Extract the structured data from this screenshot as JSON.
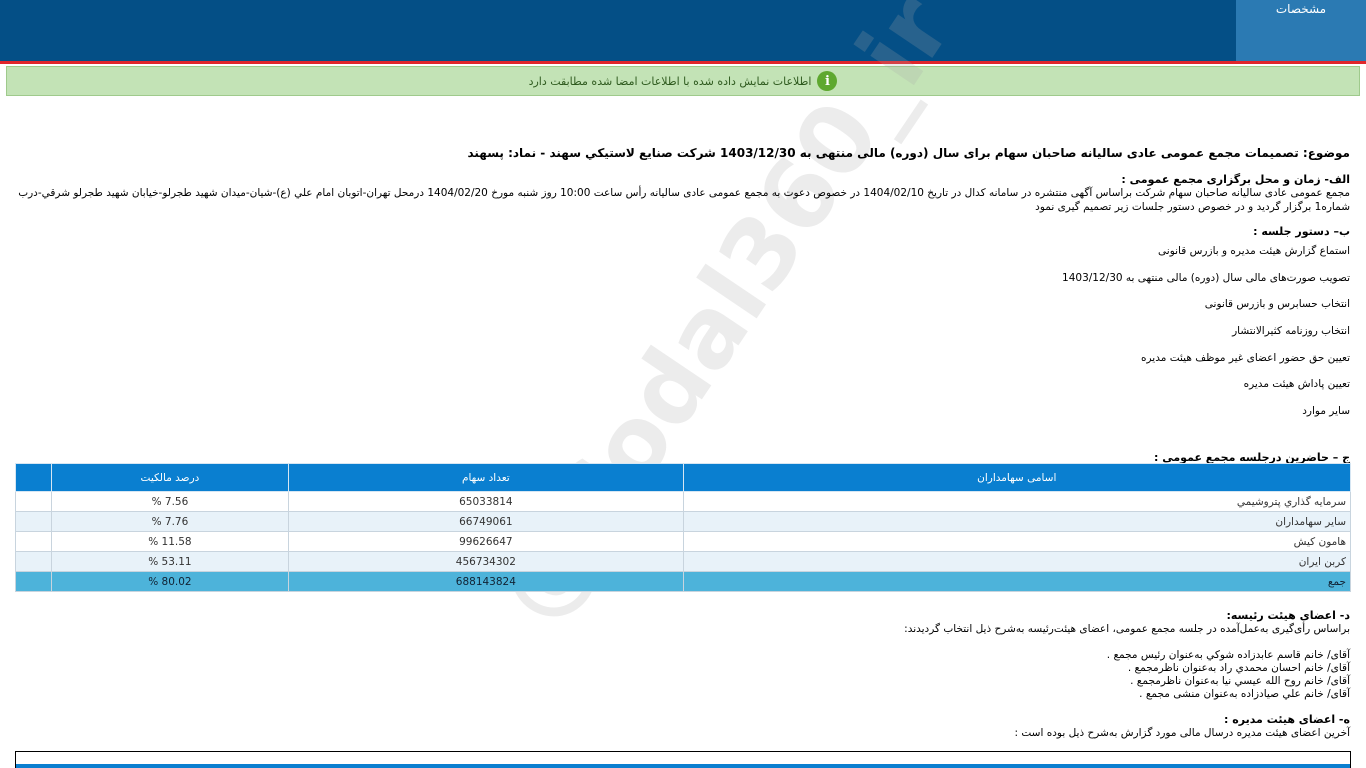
{
  "header": {
    "tab_label": "مشخصات"
  },
  "notice": {
    "text": "اطلاعات نمایش داده شده با اطلاعات امضا شده مطابقت دارد"
  },
  "subject": "موضوع: تصمیمات مجمع عمومی عادی سالیانه صاحبان سهام برای سال (دوره) مالی منتهی به 1403/12/30 شرکت صنايع لاستيكي سهند - نماد: پسهند",
  "section_a": {
    "title": "الف- زمان و محل برگزاری مجمع عمومی :",
    "line1": "مجمع عمومی عادی سالیانه صاحبان سهام شرکت براساس آگهی منتشره در سامانه کدال در تاریخ 1404/02/10 در خصوص دعوت به مجمع عمومی عادی سالیانه رأس ساعت 10:00 روز شنبه مورخ 1404/02/20 درمحل  تهران-اتوبان امام علي (ع)-شيان-ميدان شهيد طجرلو-خيابان شهيد طجرلو شرقي-درب",
    "line2": "شماره1   برگزار گردید و در خصوص دستور جلسات زیر تصمیم گیری نمود"
  },
  "section_b": {
    "title": "ب– دستور جلسه :",
    "items": [
      "استماع گزارش هیئت مدیره و بازرس قانونی",
      "تصویب صورت‌های مالی سال (دوره) مالی منتهی به 1403/12/30",
      "انتخاب حسابرس و بازرس قانونی",
      "انتخاب روزنامه كثيرالانتشار",
      "تعیین حق حضور اعضای غیر موظف هیئت مدیره",
      "تعیین پاداش هیئت مدیره",
      "سایر موارد"
    ]
  },
  "section_c": {
    "title": "ج – حاضرین درجلسه مجمع عمومی :",
    "columns": [
      "اسامی سهامداران",
      "تعداد سهام",
      "درصد مالکیت"
    ],
    "rows": [
      {
        "name": "سرمايه گذاري پتروشيمي",
        "shares": "65033814",
        "percent": "7.56 %"
      },
      {
        "name": "ساير سهامداران",
        "shares": "66749061",
        "percent": "7.76 %"
      },
      {
        "name": "هامون كيش",
        "shares": "99626647",
        "percent": "11.58 %"
      },
      {
        "name": "كربن ايران",
        "shares": "456734302",
        "percent": "53.11 %"
      },
      {
        "name": "جمع",
        "shares": "688143824",
        "percent": "80.02 %"
      }
    ]
  },
  "section_d": {
    "title": "د- اعضای هیئت رئیسه:",
    "intro": "براساس رأی‌گیری به‌عمل‌آمده در جلسه مجمع عمومی، اعضای هیئت‌رئیسه به‌شرح ذیل انتخاب گردیدند:",
    "members": [
      "آقای/ خانم  قاسم عابدزاده شوكي  به‌عنوان رئیس مجمع .",
      "آقای/ خانم  احسان محمدي راد  به‌عنوان ناظرمجمع .",
      "آقای/ خانم  روح الله عيسي نيا  به‌عنوان ناظرمجمع .",
      "آقای/ خانم  علي صيادزاده  به‌عنوان منشی مجمع ."
    ]
  },
  "section_e": {
    "title": "ه- اعضای هیئت مدیره :",
    "intro": "آخرین اعضای هیئت مدیره درسال مالی مورد گزارش به‌شرح ذیل بوده است :"
  },
  "watermark": "@Codal360_ir",
  "colors": {
    "header": "#044f86",
    "tab": "#2b7ab3",
    "notice_bg": "#c3e3b6",
    "table_header": "#0a7fd0",
    "total_row": "#4db3da"
  }
}
